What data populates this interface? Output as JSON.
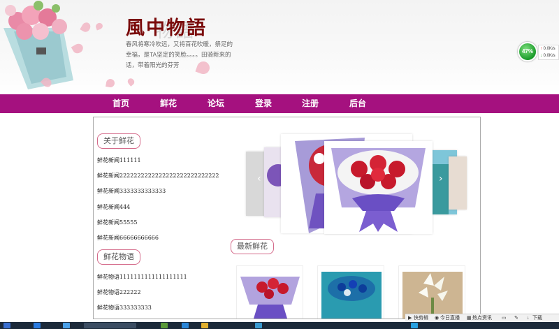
{
  "header": {
    "logo_title": "風中物語",
    "logo_ghost": "物語",
    "tagline": "春风将寒冷吹远，又将百花吹暖，祭足的幸福，是TA坚定的笑脸。。。。田骑新来的话，带着阳光的芬芳"
  },
  "network_widget": {
    "percent": "47%",
    "upload": "0.0K/s",
    "download": "0.0K/s"
  },
  "nav": {
    "items": [
      "首页",
      "鲜花",
      "论坛",
      "登录",
      "注册",
      "后台"
    ]
  },
  "about": {
    "heading": "关于鲜花",
    "items": [
      "鲜花新闻111111",
      "鲜花新闻2222222222222222222222222222",
      "鲜花新闻3333333333333",
      "鲜花新闻444",
      "鲜花新闻55555",
      "鲜花新闻66666666666"
    ]
  },
  "story": {
    "heading": "鲜花物语",
    "items": [
      "鲜花物语1111111111111111111",
      "鲜花物语222222",
      "鲜花物语333333333"
    ]
  },
  "latest": {
    "heading": "最新鲜花"
  },
  "statusbar": {
    "items": [
      "快剪辑",
      "今日直播",
      "热点资讯",
      "下载"
    ]
  },
  "colors": {
    "nav_bg": "#a5117f",
    "heading_border": "#d46a8a",
    "logo": "#7a0a0a"
  }
}
